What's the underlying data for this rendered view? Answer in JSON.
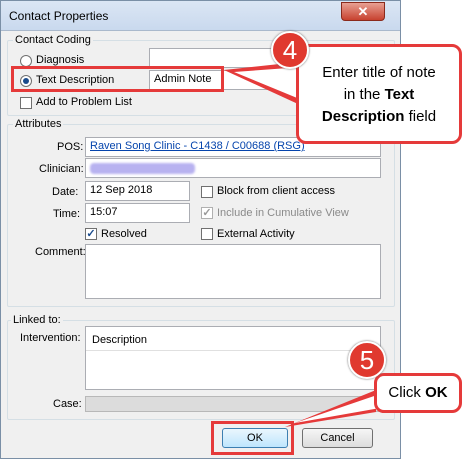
{
  "window": {
    "title": "Contact Properties",
    "close_glyph": "✕"
  },
  "contact_coding": {
    "group_label": "Contact Coding",
    "diagnosis_label": "Diagnosis",
    "diagnosis_value": "",
    "text_description_label": "Text Description",
    "text_description_value": "Admin Note",
    "selected_option": "Text Description",
    "add_to_problem_list_label": "Add to Problem List",
    "add_to_problem_list_checked": false
  },
  "attributes": {
    "group_label": "Attributes",
    "pos_label": "POS:",
    "pos_value": "Raven Song Clinic - C1438 / C00688 (RSG)",
    "clinician_label": "Clinician:",
    "date_label": "Date:",
    "date_value": "12 Sep 2018",
    "time_label": "Time:",
    "time_value": "15:07",
    "block_label": "Block from client access",
    "block_checked": false,
    "include_label": "Include in Cumulative View",
    "include_checked": true,
    "resolved_label": "Resolved",
    "resolved_checked": true,
    "external_label": "External Activity",
    "external_checked": false,
    "comment_label": "Comment:",
    "comment_value": ""
  },
  "linked_to": {
    "group_label": "Linked to:",
    "intervention_label": "Intervention:",
    "intervention_column_header": "Description",
    "case_label": "Case:"
  },
  "buttons": {
    "ok_label": "OK",
    "cancel_label": "Cancel"
  },
  "callouts": {
    "step4_number": "4",
    "step4_text_1": "Enter title of note",
    "step4_text_2": "in the ",
    "step4_text_bold_1": "Text",
    "step4_text_bold_2": "Description",
    "step4_text_3": " field",
    "step5_number": "5",
    "step5_text": "Click ",
    "step5_text_bold": "OK",
    "accent_color": "#e53a3a"
  }
}
